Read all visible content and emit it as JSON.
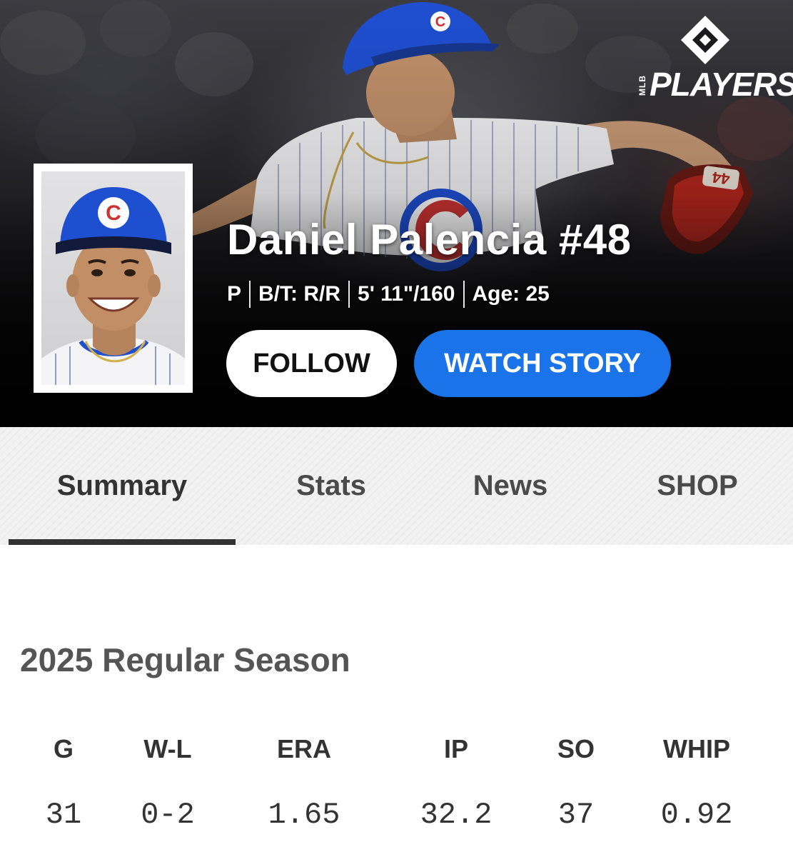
{
  "hero": {
    "player_name": "Daniel Palencia #48",
    "meta": {
      "position": "P",
      "bats_throws": "B/T: R/R",
      "height_weight": "5' 11\"/160",
      "age": "Age: 25"
    },
    "follow_label": "FOLLOW",
    "watch_label": "WATCH STORY",
    "brand": {
      "small": "MLB",
      "name": "PLAYERS"
    },
    "cap_letter": "C",
    "glove_number": "44"
  },
  "tabs": [
    {
      "label": "Summary",
      "active": true
    },
    {
      "label": "Stats",
      "active": false
    },
    {
      "label": "News",
      "active": false
    },
    {
      "label": "SHOP",
      "active": false
    }
  ],
  "season": {
    "title": "2025 Regular Season",
    "headers": [
      "G",
      "W-L",
      "ERA",
      "IP",
      "SO",
      "WHIP"
    ],
    "values": [
      "31",
      "0-2",
      "1.65",
      "32.2",
      "37",
      "0.92"
    ]
  },
  "colors": {
    "accent_blue": "#1a73e8",
    "cubs_blue": "#1f4fd1",
    "cubs_red": "#cc3433"
  }
}
